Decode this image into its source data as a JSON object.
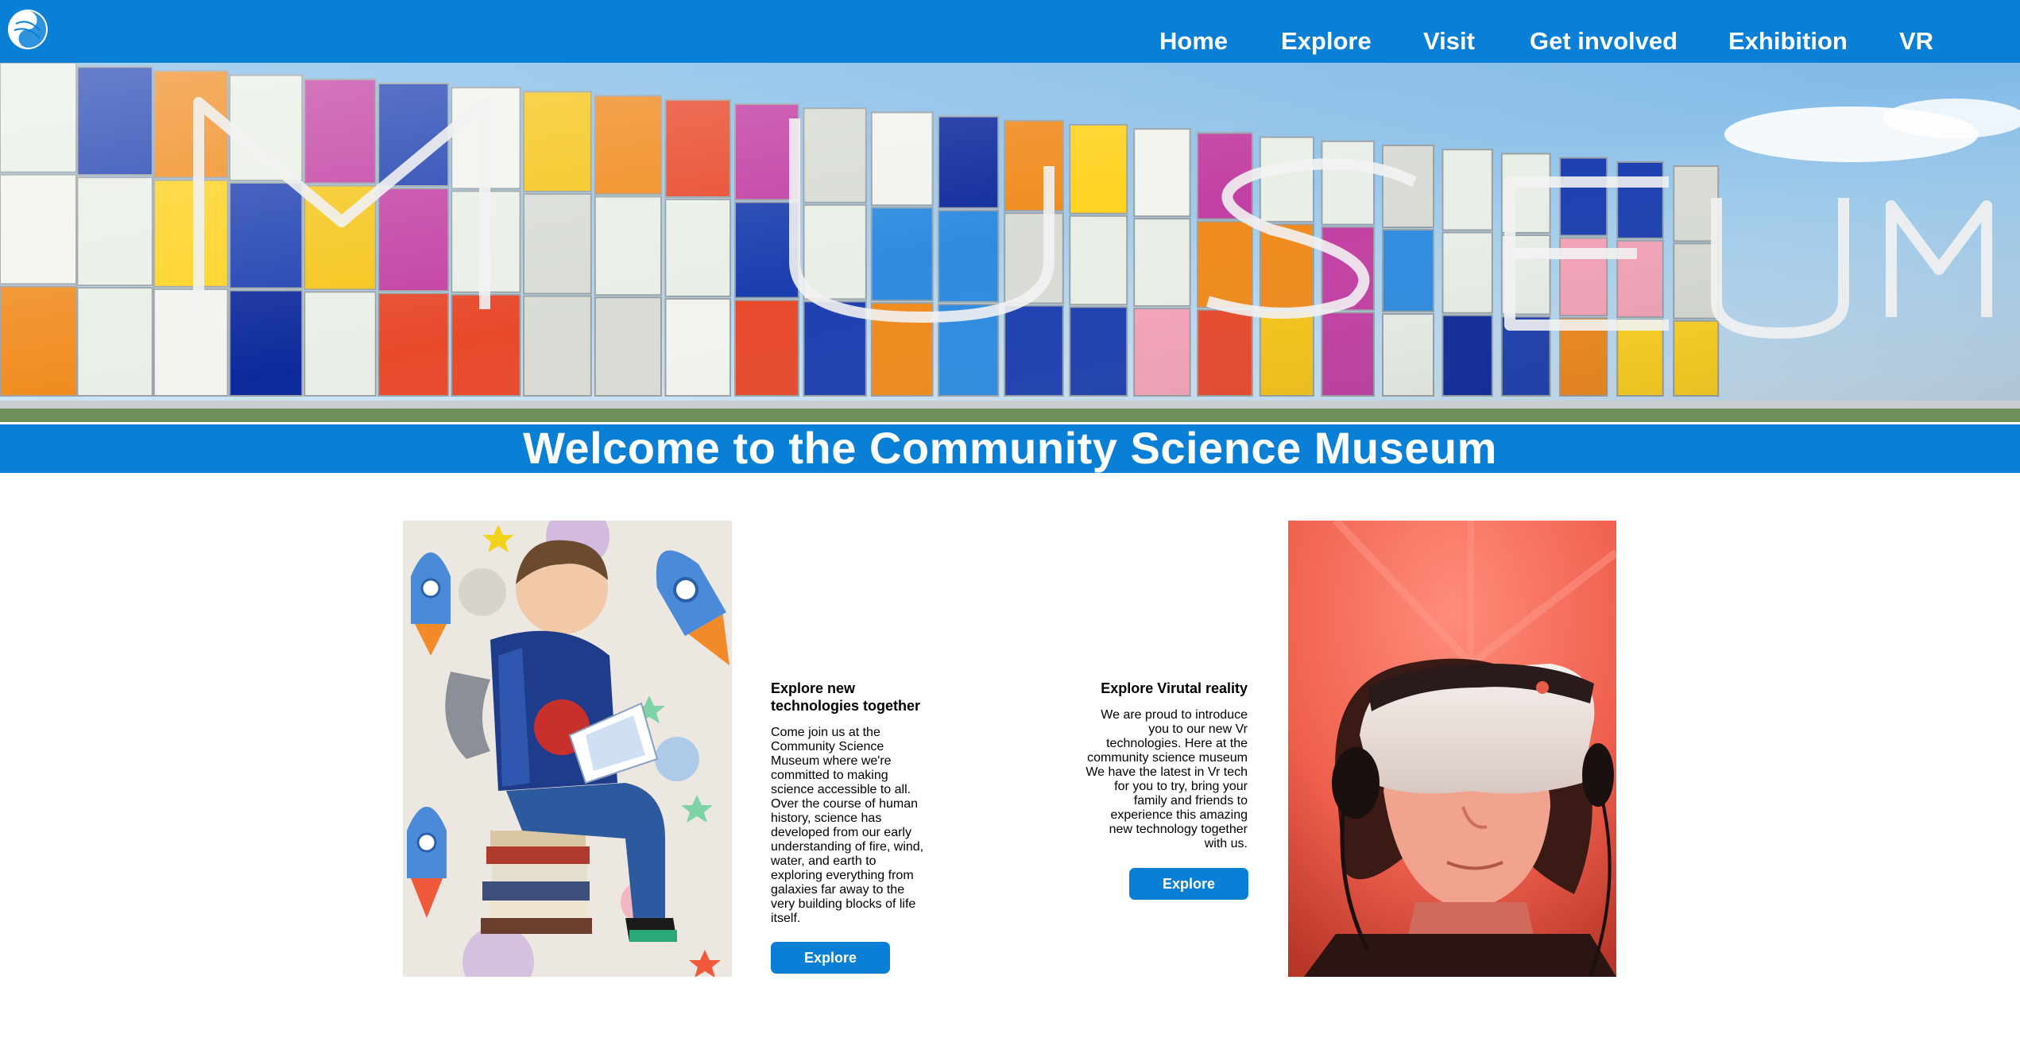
{
  "header": {
    "logo_icon": "swirl-logo-icon",
    "nav": [
      "Home",
      "Explore",
      "Visit",
      "Get involved",
      "Exhibition",
      "VR"
    ]
  },
  "hero": {
    "image": "museum-facade-colorful-glass",
    "banner_title": "Welcome to the Community Science Museum"
  },
  "cards": [
    {
      "image": "boy-reading-book-rockets",
      "title": "Explore new technologies together",
      "body": "Come join us at the Community Science Museum where we're committed to making science accessible to all. Over the course of human history, science has developed from our early understanding of fire, wind, water, and earth to exploring everything from galaxies far away to the very building blocks of life itself.",
      "button": "Explore"
    },
    {
      "image": "child-vr-headset-red-light",
      "title": "Explore Virutal reality",
      "body": "We are proud to introduce you to our new Vr technologies. Here at the community science museum We have the latest in Vr tech for you to try, bring your family and friends to experience this amazing new technology together with us.",
      "button": "Explore"
    }
  ],
  "colors": {
    "brand_blue": "#0a7fd6",
    "white": "#ffffff"
  }
}
